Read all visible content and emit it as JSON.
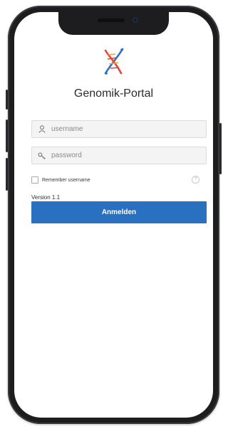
{
  "app": {
    "title": "Genomik-Portal",
    "logo_icon": "dna-helix-icon"
  },
  "form": {
    "username_placeholder": "username",
    "username_icon": "user-icon",
    "password_placeholder": "password",
    "password_icon": "key-icon",
    "remember_label": "Remember username",
    "remember_checked": false,
    "help_icon": "question-circle-icon",
    "help_symbol": "?",
    "version_text": "Version 1.1",
    "submit_label": "Anmelden"
  },
  "colors": {
    "accent": "#2a70c0",
    "logo_red": "#e2463a",
    "logo_blue": "#2b6fc5",
    "logo_orange": "#f1a53b"
  }
}
